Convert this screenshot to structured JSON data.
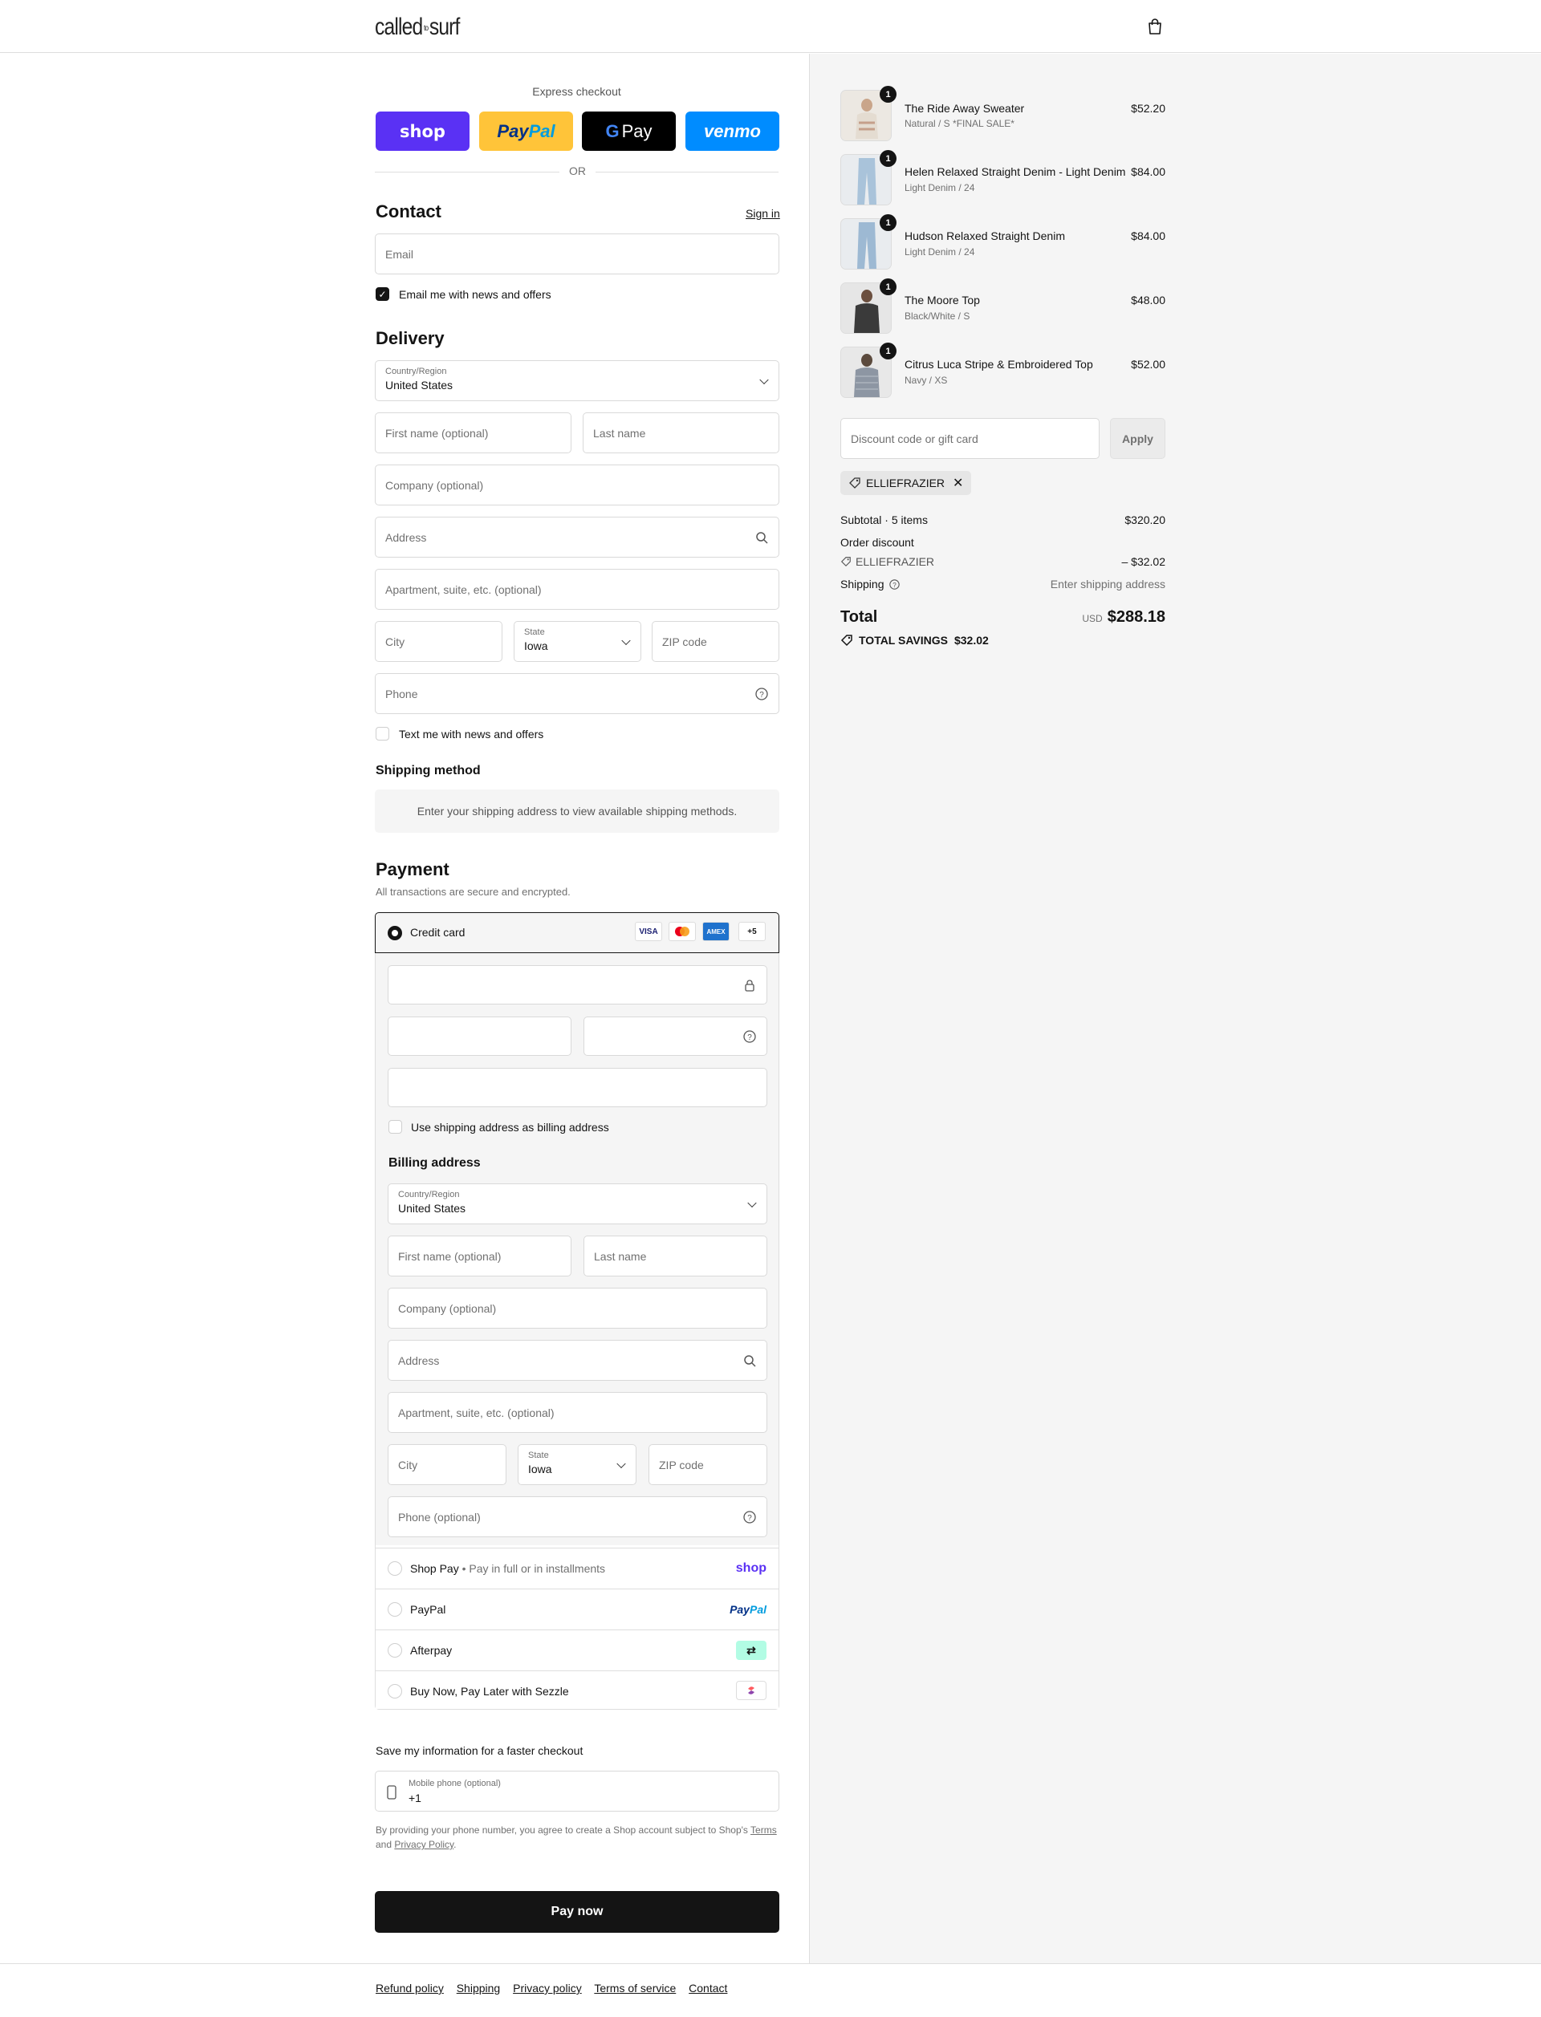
{
  "header": {
    "logo_main": "called",
    "logo_small": "to",
    "logo_end": "surf"
  },
  "express": {
    "title": "Express checkout",
    "or": "OR"
  },
  "contact": {
    "title": "Contact",
    "sign_in": "Sign in",
    "email_placeholder": "Email",
    "newsletter_label": "Email me with news and offers"
  },
  "delivery": {
    "title": "Delivery",
    "country_label": "Country/Region",
    "country_value": "United States",
    "first_name": "First name (optional)",
    "last_name": "Last name",
    "company": "Company (optional)",
    "address": "Address",
    "apartment": "Apartment, suite, etc. (optional)",
    "city": "City",
    "state_label": "State",
    "state_value": "Iowa",
    "zip": "ZIP code",
    "phone": "Phone",
    "sms_label": "Text me with news and offers"
  },
  "shipping_method": {
    "title": "Shipping method",
    "info": "Enter your shipping address to view available shipping methods."
  },
  "payment": {
    "title": "Payment",
    "subtitle": "All transactions are secure and encrypted.",
    "credit_card": "Credit card",
    "more_cards": "+5",
    "billing_same": "Use shipping address as billing address",
    "billing_title": "Billing address",
    "phone_optional": "Phone (optional)",
    "shop_pay": "Shop Pay",
    "shop_pay_sub": "Pay in full or in installments",
    "paypal": "PayPal",
    "afterpay": "Afterpay",
    "sezzle": "Buy Now, Pay Later with Sezzle"
  },
  "save_info": {
    "title": "Save my information for a faster checkout",
    "mobile_label": "Mobile phone (optional)",
    "mobile_value": "+1",
    "legal_1": "By providing your phone number, you agree to create a Shop account subject to Shop's",
    "terms": "Terms",
    "legal_and": "and",
    "privacy": "Privacy Policy",
    "legal_end": "."
  },
  "pay_now": "Pay now",
  "footer": [
    "Refund policy",
    "Shipping",
    "Privacy policy",
    "Terms of service",
    "Contact"
  ],
  "order": {
    "items": [
      {
        "name": "The Ride Away Sweater",
        "variant": "Natural / S *FINAL SALE*",
        "price": "$52.20",
        "qty": "1"
      },
      {
        "name": "Helen Relaxed Straight Denim - Light Denim",
        "variant": "Light Denim / 24",
        "price": "$84.00",
        "qty": "1"
      },
      {
        "name": "Hudson Relaxed Straight Denim",
        "variant": "Light Denim / 24",
        "price": "$84.00",
        "qty": "1"
      },
      {
        "name": "The Moore Top",
        "variant": "Black/White / S",
        "price": "$48.00",
        "qty": "1"
      },
      {
        "name": "Citrus Luca Stripe & Embroidered Top",
        "variant": "Navy / XS",
        "price": "$52.00",
        "qty": "1"
      }
    ],
    "discount_placeholder": "Discount code or gift card",
    "apply": "Apply",
    "code": "ELLIEFRAZIER",
    "subtotal_label": "Subtotal · 5 items",
    "subtotal_value": "$320.20",
    "order_discount": "Order discount",
    "discount_value": "– $32.02",
    "shipping_label": "Shipping",
    "shipping_value": "Enter shipping address",
    "total_label": "Total",
    "currency": "USD",
    "total_value": "$288.18",
    "savings_label": "TOTAL SAVINGS",
    "savings_value": "$32.02"
  }
}
